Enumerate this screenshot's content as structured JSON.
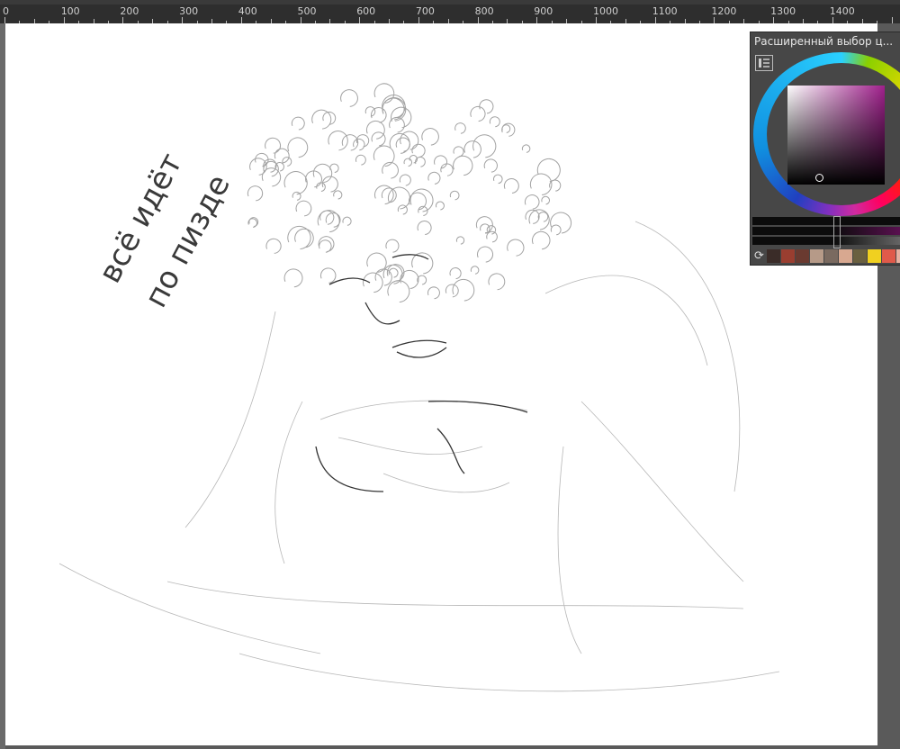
{
  "ruler": {
    "labels": [
      "0",
      "100",
      "200",
      "300",
      "400",
      "500",
      "600",
      "700",
      "800",
      "900",
      "1000",
      "1100",
      "1200",
      "1300",
      "1400"
    ]
  },
  "color_panel": {
    "title": "Расширенный выбор ц...",
    "menu_icon": "list-icon",
    "refresh_icon": "refresh-icon",
    "current_hue_color": "#a0208c",
    "swatches": [
      "#3a2c28",
      "#9a3e30",
      "#6a3a30",
      "#b69a88",
      "#7a6a60",
      "#d8a890",
      "#6a6040",
      "#f0d020",
      "#e05a4a",
      "#e8b0a0"
    ]
  },
  "canvas": {
    "lettering": "всё идёт по пизде"
  }
}
